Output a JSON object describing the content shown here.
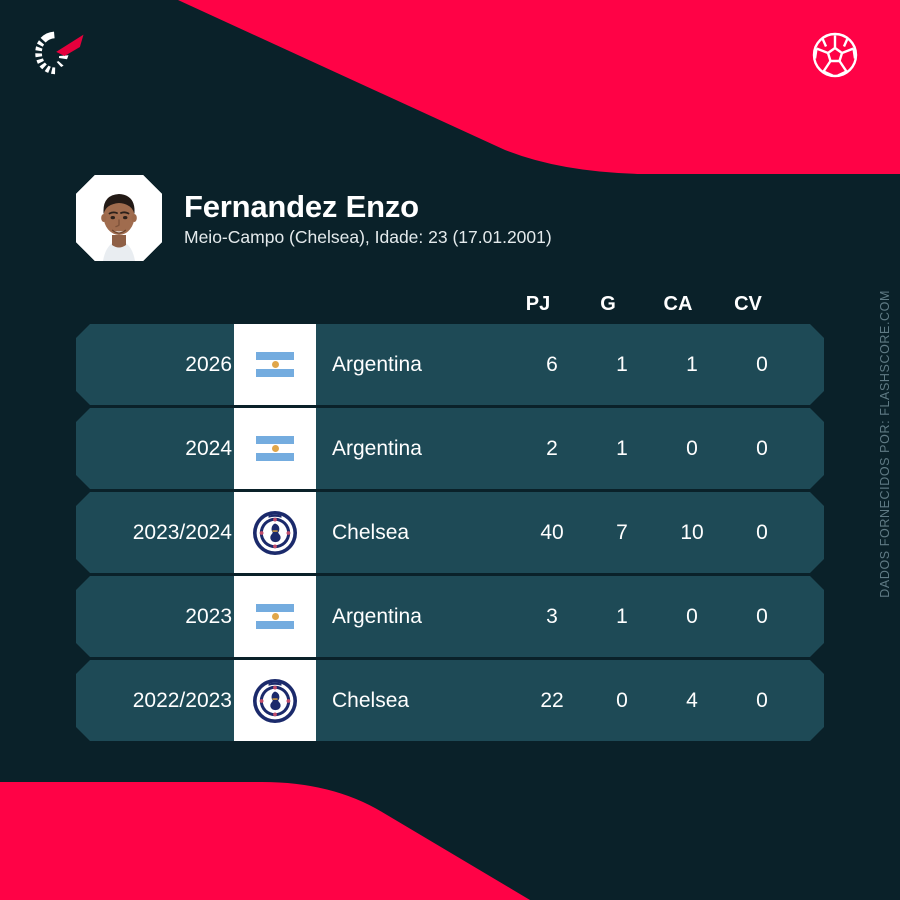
{
  "brand": {
    "logo_icon": "flashscore-logo-icon",
    "ball_icon": "football-ball-icon",
    "accent_red": "#FF0246",
    "background": "#0A2129",
    "row_background": "#1E4A56"
  },
  "player": {
    "avatar_icon": "player-photo",
    "name": "Fernandez Enzo",
    "meta": "Meio-Campo (Chelsea), Idade: 23 (17.01.2001)"
  },
  "table": {
    "columns": [
      "PJ",
      "G",
      "CA",
      "CV"
    ],
    "rows": [
      {
        "season": "2026",
        "badge_icon": "flag-argentina",
        "team": "Argentina",
        "pj": "6",
        "g": "1",
        "ca": "1",
        "cv": "0"
      },
      {
        "season": "2024",
        "badge_icon": "flag-argentina",
        "team": "Argentina",
        "pj": "2",
        "g": "1",
        "ca": "0",
        "cv": "0"
      },
      {
        "season": "2023/2024",
        "badge_icon": "crest-chelsea",
        "team": "Chelsea",
        "pj": "40",
        "g": "7",
        "ca": "10",
        "cv": "0"
      },
      {
        "season": "2023",
        "badge_icon": "flag-argentina",
        "team": "Argentina",
        "pj": "3",
        "g": "1",
        "ca": "0",
        "cv": "0"
      },
      {
        "season": "2022/2023",
        "badge_icon": "crest-chelsea",
        "team": "Chelsea",
        "pj": "22",
        "g": "0",
        "ca": "4",
        "cv": "0"
      }
    ]
  },
  "credit": {
    "text": "DADOS FORNECIDOS POR: FLASHSCORE.COM"
  }
}
